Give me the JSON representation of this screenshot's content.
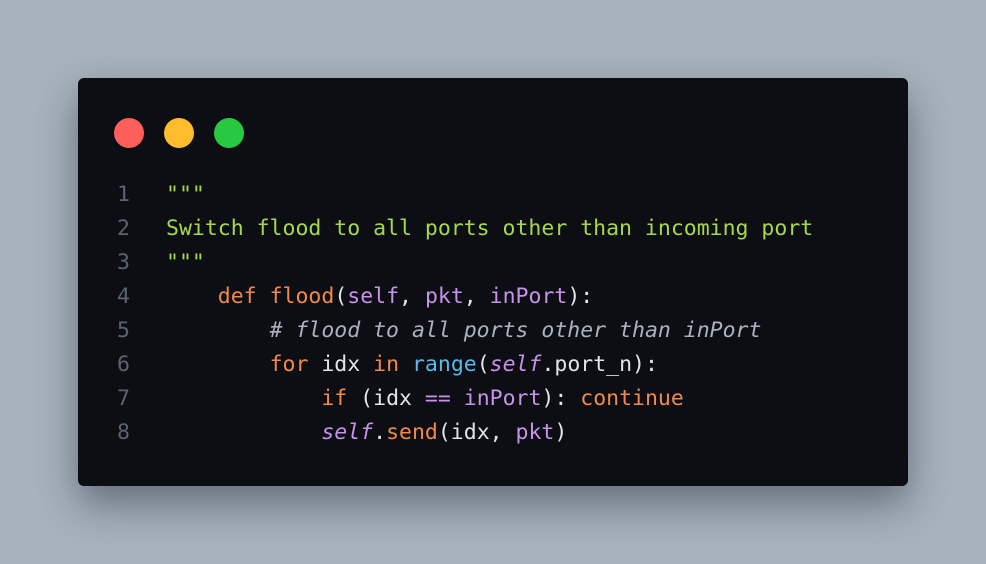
{
  "window": {
    "controls": [
      "close",
      "minimize",
      "maximize"
    ],
    "colors": {
      "close": "#ff5f5a",
      "minimize": "#ffbd2e",
      "maximize": "#28c940",
      "background": "#0c0e14",
      "page_background": "#a7b2bc"
    }
  },
  "code": {
    "lines": [
      {
        "number": "1",
        "tokens": [
          {
            "text": "\"\"\"",
            "kind": "string"
          }
        ]
      },
      {
        "number": "2",
        "tokens": [
          {
            "text": "Switch flood to all ports other than incoming port",
            "kind": "string"
          }
        ]
      },
      {
        "number": "3",
        "tokens": [
          {
            "text": "\"\"\"",
            "kind": "string"
          }
        ]
      },
      {
        "number": "4",
        "tokens": [
          {
            "text": "    ",
            "kind": "plain"
          },
          {
            "text": "def",
            "kind": "keyword"
          },
          {
            "text": " ",
            "kind": "plain"
          },
          {
            "text": "flood",
            "kind": "func"
          },
          {
            "text": "(",
            "kind": "plain"
          },
          {
            "text": "self",
            "kind": "param"
          },
          {
            "text": ", ",
            "kind": "plain"
          },
          {
            "text": "pkt",
            "kind": "param"
          },
          {
            "text": ", ",
            "kind": "plain"
          },
          {
            "text": "inPort",
            "kind": "param"
          },
          {
            "text": "):",
            "kind": "plain"
          }
        ]
      },
      {
        "number": "5",
        "tokens": [
          {
            "text": "        ",
            "kind": "plain"
          },
          {
            "text": "# flood to all ports other than inPort",
            "kind": "comment"
          }
        ]
      },
      {
        "number": "6",
        "tokens": [
          {
            "text": "        ",
            "kind": "plain"
          },
          {
            "text": "for",
            "kind": "keyword"
          },
          {
            "text": " idx ",
            "kind": "plain"
          },
          {
            "text": "in",
            "kind": "keyword"
          },
          {
            "text": " ",
            "kind": "plain"
          },
          {
            "text": "range",
            "kind": "builtin"
          },
          {
            "text": "(",
            "kind": "plain"
          },
          {
            "text": "self",
            "kind": "self"
          },
          {
            "text": ".port_n):",
            "kind": "plain"
          }
        ]
      },
      {
        "number": "7",
        "tokens": [
          {
            "text": "            ",
            "kind": "plain"
          },
          {
            "text": "if",
            "kind": "keyword"
          },
          {
            "text": " (idx ",
            "kind": "plain"
          },
          {
            "text": "==",
            "kind": "op"
          },
          {
            "text": " ",
            "kind": "plain"
          },
          {
            "text": "inPort",
            "kind": "param"
          },
          {
            "text": "): ",
            "kind": "plain"
          },
          {
            "text": "continue",
            "kind": "keyword"
          }
        ]
      },
      {
        "number": "8",
        "tokens": [
          {
            "text": "            ",
            "kind": "plain"
          },
          {
            "text": "self",
            "kind": "self"
          },
          {
            "text": ".",
            "kind": "plain"
          },
          {
            "text": "send",
            "kind": "func"
          },
          {
            "text": "(idx, ",
            "kind": "plain"
          },
          {
            "text": "pkt",
            "kind": "param"
          },
          {
            "text": ")",
            "kind": "plain"
          }
        ]
      }
    ]
  }
}
